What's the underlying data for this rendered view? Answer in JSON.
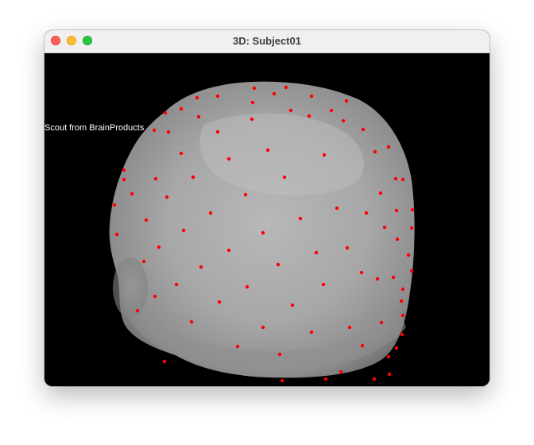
{
  "window": {
    "title": "3D: Subject01"
  },
  "viewport": {
    "background_color": "#000000",
    "surface_color": "#a9a9a9",
    "sensor_color": "#ff0000",
    "overlay_label": "Scout from BrainProducts"
  },
  "icons": {
    "close": "close-icon",
    "minimize": "minimize-icon",
    "zoom": "zoom-icon"
  }
}
